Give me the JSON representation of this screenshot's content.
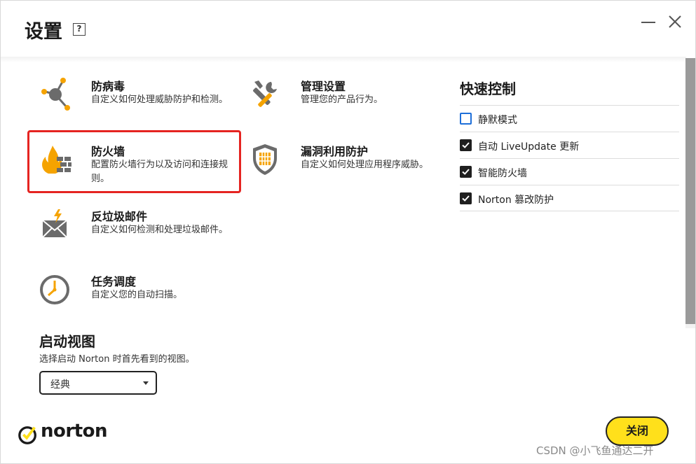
{
  "header": {
    "title": "设置",
    "help_label": "?"
  },
  "categories": [
    {
      "name": "防病毒",
      "desc": "自定义如何处理威胁防护和检测。",
      "icon": "network-virus-icon"
    },
    {
      "name": "管理设置",
      "desc": "管理您的产品行为。",
      "icon": "tools-icon"
    },
    {
      "name": "防火墙",
      "desc": "配置防火墙行为以及访问和连接规则。",
      "icon": "firewall-icon",
      "highlighted": true
    },
    {
      "name": "漏洞利用防护",
      "desc": "自定义如何处理应用程序威胁。",
      "icon": "shield-icon"
    },
    {
      "name": "反垃圾邮件",
      "desc": "自定义如何检测和处理垃圾邮件。",
      "icon": "spam-mail-icon"
    },
    {
      "name": "任务调度",
      "desc": "自定义您的自动扫描。",
      "icon": "clock-icon"
    }
  ],
  "quick_controls": {
    "title": "快速控制",
    "items": [
      {
        "label": "静默模式",
        "checked": false
      },
      {
        "label": "自动 LiveUpdate 更新",
        "checked": true
      },
      {
        "label": "智能防火墙",
        "checked": true
      },
      {
        "label": "Norton 篡改防护",
        "checked": true
      }
    ]
  },
  "startup_view": {
    "title": "启动视图",
    "desc": "选择启动 Norton 时首先看到的视图。",
    "selected": "经典"
  },
  "logo": {
    "text": "norton",
    "tm": "™"
  },
  "footer": {
    "close_label": "关闭"
  },
  "watermark": "CSDN @小飞鱼通达二开",
  "colors": {
    "accent_yellow": "#ffe01b",
    "icon_orange": "#f5a300",
    "icon_gray": "#6b6b6b",
    "highlight_red": "#e52421",
    "checkbox_blue": "#1e6fd9"
  }
}
